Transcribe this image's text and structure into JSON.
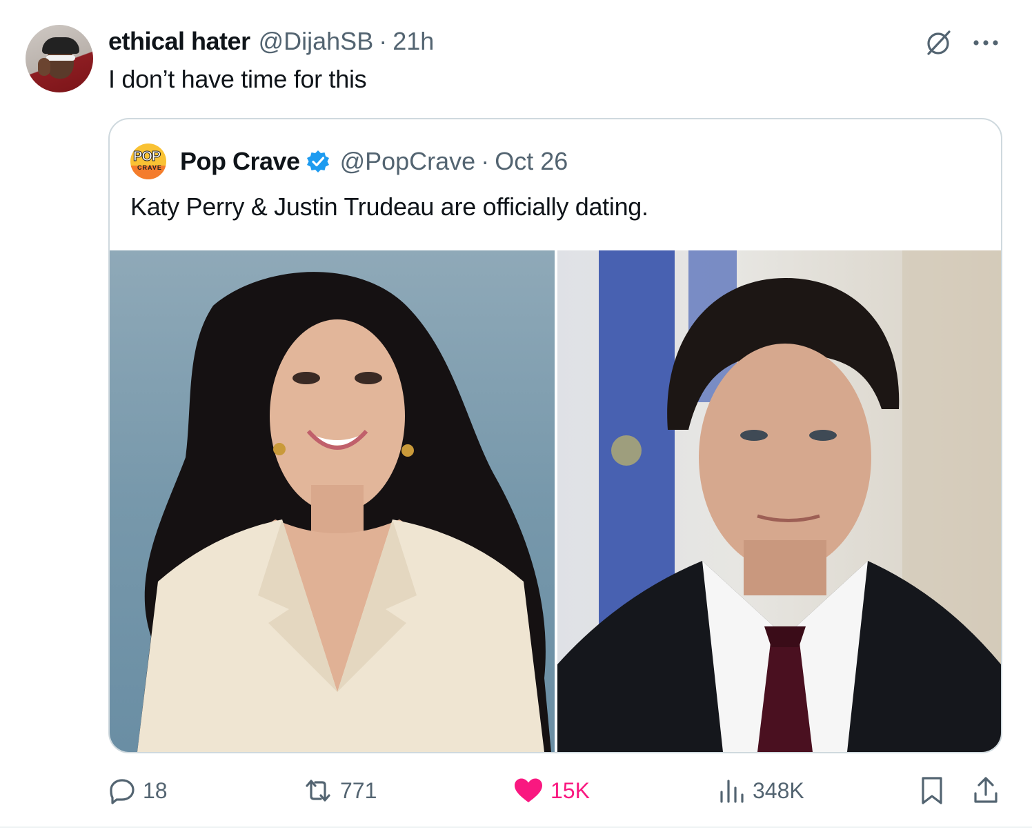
{
  "tweet": {
    "author_name": "ethical hater",
    "author_handle": "@DijahSB",
    "separator": "·",
    "time": "21h",
    "text": "I don’t have time for this"
  },
  "quote": {
    "logo_line1": "POP",
    "logo_line2": "CRAVE",
    "author_name": "Pop Crave",
    "author_handle": "@PopCrave",
    "separator": "·",
    "date": "Oct 26",
    "text": "Katy Perry & Justin Trudeau are officially dating."
  },
  "actions": {
    "replies": "18",
    "reposts": "771",
    "likes": "15K",
    "views": "348K"
  },
  "colors": {
    "text": "#0f1419",
    "muted": "#536471",
    "like": "#f91880",
    "verified": "#1d9bf0",
    "border": "#cfd9de"
  },
  "icons": {
    "top_right": [
      "grok-icon",
      "more-icon"
    ],
    "actions": [
      "reply-icon",
      "repost-icon",
      "heart-icon",
      "views-icon",
      "bookmark-icon",
      "share-icon"
    ]
  }
}
